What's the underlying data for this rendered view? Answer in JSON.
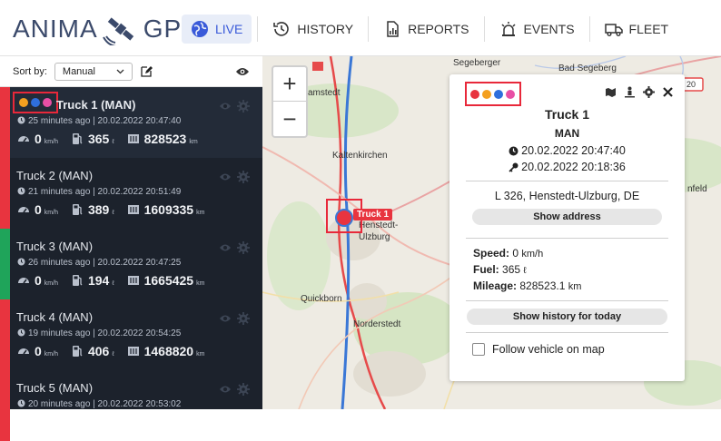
{
  "app": {
    "logo_left": "ANIMA",
    "logo_right": "GPS"
  },
  "nav": [
    {
      "label": "LIVE",
      "icon": "globe-icon",
      "active": true
    },
    {
      "label": "HISTORY",
      "icon": "history-icon"
    },
    {
      "label": "REPORTS",
      "icon": "report-icon"
    },
    {
      "label": "EVENTS",
      "icon": "alarm-icon"
    },
    {
      "label": "FLEET",
      "icon": "truck-icon"
    }
  ],
  "sidebar": {
    "sort_label": "Sort by:",
    "sort_value": "Manual",
    "trucks": [
      {
        "name": "Truck 1 (MAN)",
        "time": "25 minutes ago | 20.02.2022 20:47:40",
        "speed": "0",
        "speed_unit": "km/h",
        "fuel": "365",
        "fuel_unit": "ℓ",
        "mileage": "828523",
        "mileage_unit": "km",
        "stripe": "#e8343f"
      },
      {
        "name": "Truck 2 (MAN)",
        "time": "21 minutes ago | 20.02.2022 20:51:49",
        "speed": "0",
        "speed_unit": "km/h",
        "fuel": "389",
        "fuel_unit": "ℓ",
        "mileage": "1609335",
        "mileage_unit": "km",
        "stripe": "#e8343f"
      },
      {
        "name": "Truck 3 (MAN)",
        "time": "26 minutes ago | 20.02.2022 20:47:25",
        "speed": "0",
        "speed_unit": "km/h",
        "fuel": "194",
        "fuel_unit": "ℓ",
        "mileage": "1665425",
        "mileage_unit": "km",
        "stripe": "#1fa45a"
      },
      {
        "name": "Truck 4 (MAN)",
        "time": "19 minutes ago | 20.02.2022 20:54:25",
        "speed": "0",
        "speed_unit": "km/h",
        "fuel": "406",
        "fuel_unit": "ℓ",
        "mileage": "1468820",
        "mileage_unit": "km",
        "stripe": "#e8343f"
      },
      {
        "name": "Truck 5 (MAN)",
        "time": "20 minutes ago | 20.02.2022 20:53:02",
        "speed": "",
        "speed_unit": "",
        "fuel": "",
        "fuel_unit": "",
        "mileage": "",
        "mileage_unit": "",
        "stripe": "#e8343f"
      }
    ]
  },
  "map": {
    "marker_label": "Truck 1",
    "places": [
      "Segeberger",
      "Bad Segeberg",
      "amstedt",
      "Kaltenkirchen",
      "Henstedt-",
      "Ulzburg",
      "Quickborn",
      "Norderstedt",
      "nfeld"
    ],
    "road_badge": "20"
  },
  "popup": {
    "title": "Truck 1",
    "model": "MAN",
    "time1": "20.02.2022 20:47:40",
    "time2": "20.02.2022 20:18:36",
    "address": "L 326, Henstedt-Ulzburg, DE",
    "show_address": "Show address",
    "speed_label": "Speed:",
    "speed_value": "0",
    "speed_unit": "km/h",
    "fuel_label": "Fuel:",
    "fuel_value": "365",
    "fuel_unit": "ℓ",
    "mileage_label": "Mileage:",
    "mileage_value": "828523.1",
    "mileage_unit": "km",
    "history_button": "Show history for today",
    "follow_label": "Follow vehicle on map"
  },
  "colors": {
    "accent": "#3a5ad9",
    "dot_red": "#e8343f",
    "dot_orange": "#f4a020",
    "dot_blue": "#2f6fdc",
    "dot_pink": "#e84fa5"
  }
}
